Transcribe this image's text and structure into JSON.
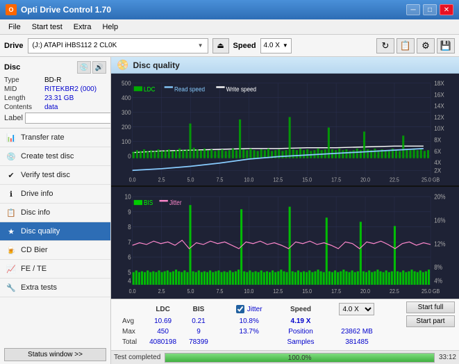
{
  "titlebar": {
    "title": "Opti Drive Control 1.70",
    "minimize": "─",
    "maximize": "□",
    "close": "✕"
  },
  "menu": {
    "items": [
      "File",
      "Start test",
      "Extra",
      "Help"
    ]
  },
  "drive_bar": {
    "label": "Drive",
    "drive_text": "(J:)  ATAPI iHBS112  2 CL0K",
    "speed_label": "Speed",
    "speed_value": "4.0 X"
  },
  "disc_panel": {
    "title": "Disc",
    "rows": [
      {
        "label": "Type",
        "value": "BD-R"
      },
      {
        "label": "MID",
        "value": "RITEKBR2 (000)"
      },
      {
        "label": "Length",
        "value": "23.31 GB"
      },
      {
        "label": "Contents",
        "value": "data"
      },
      {
        "label": "Label",
        "value": ""
      }
    ]
  },
  "nav": {
    "items": [
      {
        "id": "transfer-rate",
        "label": "Transfer rate",
        "icon": "📊"
      },
      {
        "id": "create-test-disc",
        "label": "Create test disc",
        "icon": "💿"
      },
      {
        "id": "verify-test-disc",
        "label": "Verify test disc",
        "icon": "✔"
      },
      {
        "id": "drive-info",
        "label": "Drive info",
        "icon": "ℹ"
      },
      {
        "id": "disc-info",
        "label": "Disc info",
        "icon": "📋"
      },
      {
        "id": "disc-quality",
        "label": "Disc quality",
        "icon": "★",
        "active": true
      },
      {
        "id": "cd-bier",
        "label": "CD Bier",
        "icon": "🍺"
      },
      {
        "id": "fe-te",
        "label": "FE / TE",
        "icon": "📈"
      },
      {
        "id": "extra-tests",
        "label": "Extra tests",
        "icon": "🔧"
      }
    ],
    "status_btn": "Status window >>"
  },
  "chart_header": {
    "title": "Disc quality"
  },
  "chart1": {
    "legend": [
      "LDC",
      "Read speed",
      "Write speed"
    ],
    "y_max": 500,
    "x_max": 25,
    "right_labels": [
      "18X",
      "16X",
      "14X",
      "12X",
      "10X",
      "8X",
      "6X",
      "4X",
      "2X"
    ],
    "x_ticks": [
      "0.0",
      "2.5",
      "5.0",
      "7.5",
      "10.0",
      "12.5",
      "15.0",
      "17.5",
      "20.0",
      "22.5",
      "25.0 GB"
    ]
  },
  "chart2": {
    "legend": [
      "BIS",
      "Jitter"
    ],
    "y_max": 10,
    "y_min": 1,
    "right_labels": [
      "20%",
      "16%",
      "12%",
      "8%",
      "4%"
    ],
    "x_ticks": [
      "0.0",
      "2.5",
      "5.0",
      "7.5",
      "10.0",
      "12.5",
      "15.0",
      "17.5",
      "20.0",
      "22.5",
      "25.0 GB"
    ]
  },
  "stats": {
    "headers": [
      "LDC",
      "BIS",
      "",
      "Jitter",
      "Speed"
    ],
    "avg": {
      "ldc": "10.69",
      "bis": "0.21",
      "jitter": "10.8%"
    },
    "max": {
      "ldc": "450",
      "bis": "9",
      "jitter": "13.7%"
    },
    "total": {
      "ldc": "4080198",
      "bis": "78399"
    },
    "speed": {
      "value": "4.19 X",
      "label": "Speed"
    },
    "position": {
      "label": "Position",
      "value": "23862 MB"
    },
    "samples": {
      "label": "Samples",
      "value": "381485"
    },
    "speed_select": "4.0 X",
    "jitter_checked": true,
    "jitter_label": "Jitter"
  },
  "buttons": {
    "start_full": "Start full",
    "start_part": "Start part"
  },
  "progress": {
    "status": "Test completed",
    "percent": "100.0%",
    "percent_num": 100,
    "time": "33:12"
  }
}
